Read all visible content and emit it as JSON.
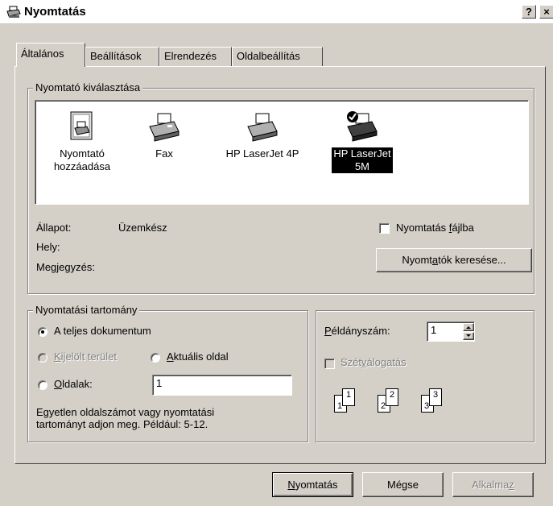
{
  "window": {
    "title": "Nyomtatás",
    "help": "?",
    "close": "×"
  },
  "tabs": [
    {
      "label": "Általános",
      "active": true
    },
    {
      "label": "Beállítások"
    },
    {
      "label": "Elrendezés"
    },
    {
      "label": "Oldalbeállítás"
    }
  ],
  "printer_select": {
    "legend": "Nyomtató kiválasztása",
    "items": [
      {
        "line1": "Nyomtató",
        "line2": "hozzáadása",
        "icon": "add-printer-icon"
      },
      {
        "line1": "Fax",
        "line2": "",
        "icon": "fax-printer-icon"
      },
      {
        "line1": "HP LaserJet 4P",
        "line2": "",
        "icon": "printer-icon"
      },
      {
        "line1": "HP LaserJet",
        "line2": "5M",
        "icon": "default-printer-icon",
        "selected": true
      }
    ],
    "status_label": "Állapot:",
    "status_value": "Üzemkész",
    "location_label": "Hely:",
    "comment_label": "Megjegyzés:",
    "print_to_file_pre": "Nyomtatás ",
    "print_to_file_u": "f",
    "print_to_file_post": "ájlba",
    "find_pre": "Nyomt",
    "find_u": "a",
    "find_post": "tók keresése..."
  },
  "range": {
    "legend": "Nyomtatási tartomány",
    "all": "A teljes dokumentum",
    "selection_u": "K",
    "selection_post": "ijelölt terület",
    "current_u": "A",
    "current_post": "ktuális oldal",
    "pages_u": "O",
    "pages_post": "ldalak:",
    "pages_value": "1",
    "hint1": "Egyetlen oldalszámot vagy nyomtatási",
    "hint2": "tartományt adjon meg. Például: 5-12."
  },
  "copies": {
    "label_u": "P",
    "label_post": "éldányszám:",
    "value": "1",
    "collate_pre": "Szét",
    "collate_u": "v",
    "collate_post": "álogatás",
    "pages": [
      "1",
      "1",
      "2",
      "2",
      "3",
      "3"
    ]
  },
  "buttons": {
    "print_u": "N",
    "print_post": "yomtatás",
    "cancel": "Mégse",
    "apply_pre": "Alkalma",
    "apply_u": "z"
  }
}
